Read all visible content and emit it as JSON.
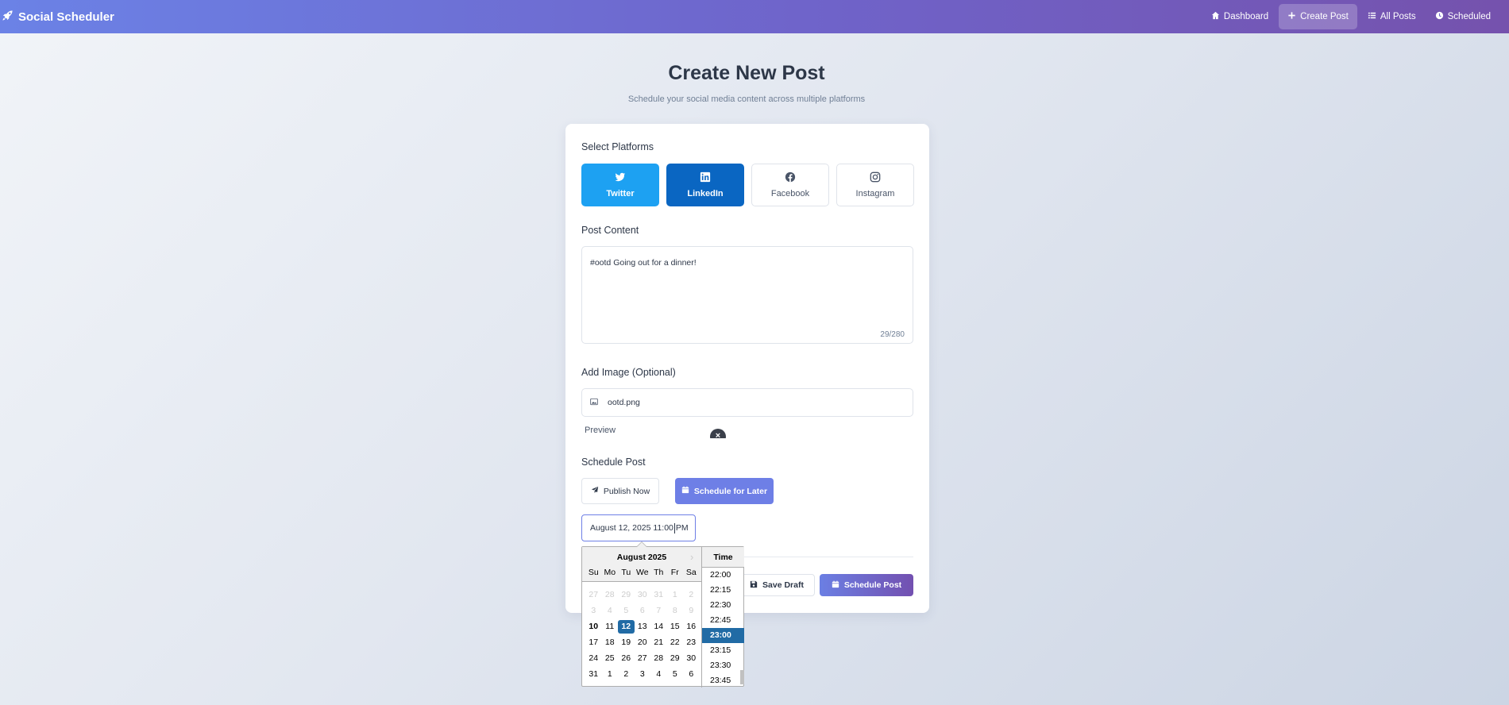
{
  "app": {
    "brand": "Social Scheduler"
  },
  "nav": [
    {
      "label": "Dashboard",
      "icon": "home-icon"
    },
    {
      "label": "Create Post",
      "icon": "plus-icon",
      "active": true
    },
    {
      "label": "All Posts",
      "icon": "list-icon"
    },
    {
      "label": "Scheduled",
      "icon": "clock-icon"
    }
  ],
  "page": {
    "title": "Create New Post",
    "subtitle": "Schedule your social media content across multiple platforms"
  },
  "form": {
    "platforms_label": "Select Platforms",
    "platforms": [
      {
        "label": "Twitter",
        "icon": "twitter-icon",
        "selected": true,
        "color": "#1da1f2"
      },
      {
        "label": "LinkedIn",
        "icon": "linkedin-icon",
        "selected": true,
        "color": "#0a66c2"
      },
      {
        "label": "Facebook",
        "icon": "facebook-icon",
        "selected": false
      },
      {
        "label": "Instagram",
        "icon": "instagram-icon",
        "selected": false
      }
    ],
    "content_label": "Post Content",
    "content_value": "#ootd Going out for a dinner!",
    "char_count": "29/280",
    "image_label": "Add Image (Optional)",
    "image_file": "ootd.png",
    "preview_alt": "Preview",
    "remove_symbol": "×",
    "schedule_label": "Schedule Post",
    "publish_now": "Publish Now",
    "schedule_later": "Schedule for Later",
    "date_value_before_caret": "August 12, 2025 11:00",
    "date_value_after_caret": "PM",
    "save_draft": "Save Draft",
    "schedule_post": "Schedule Post"
  },
  "datepicker": {
    "month_title": "August 2025",
    "next_symbol": "›",
    "weekdays": [
      "Su",
      "Mo",
      "Tu",
      "We",
      "Th",
      "Fr",
      "Sa"
    ],
    "weeks": [
      [
        {
          "d": "27",
          "out": true
        },
        {
          "d": "28",
          "out": true
        },
        {
          "d": "29",
          "out": true
        },
        {
          "d": "30",
          "out": true
        },
        {
          "d": "31",
          "out": true
        },
        {
          "d": "1",
          "out": true
        },
        {
          "d": "2",
          "out": true
        }
      ],
      [
        {
          "d": "3",
          "out": true
        },
        {
          "d": "4",
          "out": true
        },
        {
          "d": "5",
          "out": true
        },
        {
          "d": "6",
          "out": true
        },
        {
          "d": "7",
          "out": true
        },
        {
          "d": "8",
          "out": true
        },
        {
          "d": "9",
          "out": true
        }
      ],
      [
        {
          "d": "10",
          "bold": true
        },
        {
          "d": "11"
        },
        {
          "d": "12",
          "sel": true
        },
        {
          "d": "13"
        },
        {
          "d": "14"
        },
        {
          "d": "15"
        },
        {
          "d": "16"
        }
      ],
      [
        {
          "d": "17"
        },
        {
          "d": "18"
        },
        {
          "d": "19"
        },
        {
          "d": "20"
        },
        {
          "d": "21"
        },
        {
          "d": "22"
        },
        {
          "d": "23"
        }
      ],
      [
        {
          "d": "24"
        },
        {
          "d": "25"
        },
        {
          "d": "26"
        },
        {
          "d": "27"
        },
        {
          "d": "28"
        },
        {
          "d": "29"
        },
        {
          "d": "30"
        }
      ],
      [
        {
          "d": "31"
        },
        {
          "d": "1"
        },
        {
          "d": "2"
        },
        {
          "d": "3"
        },
        {
          "d": "4"
        },
        {
          "d": "5"
        },
        {
          "d": "6"
        }
      ]
    ],
    "time_header": "Time",
    "times": [
      {
        "t": "22:00"
      },
      {
        "t": "22:15"
      },
      {
        "t": "22:30"
      },
      {
        "t": "22:45"
      },
      {
        "t": "23:00",
        "sel": true
      },
      {
        "t": "23:15"
      },
      {
        "t": "23:30"
      },
      {
        "t": "23:45"
      }
    ]
  }
}
